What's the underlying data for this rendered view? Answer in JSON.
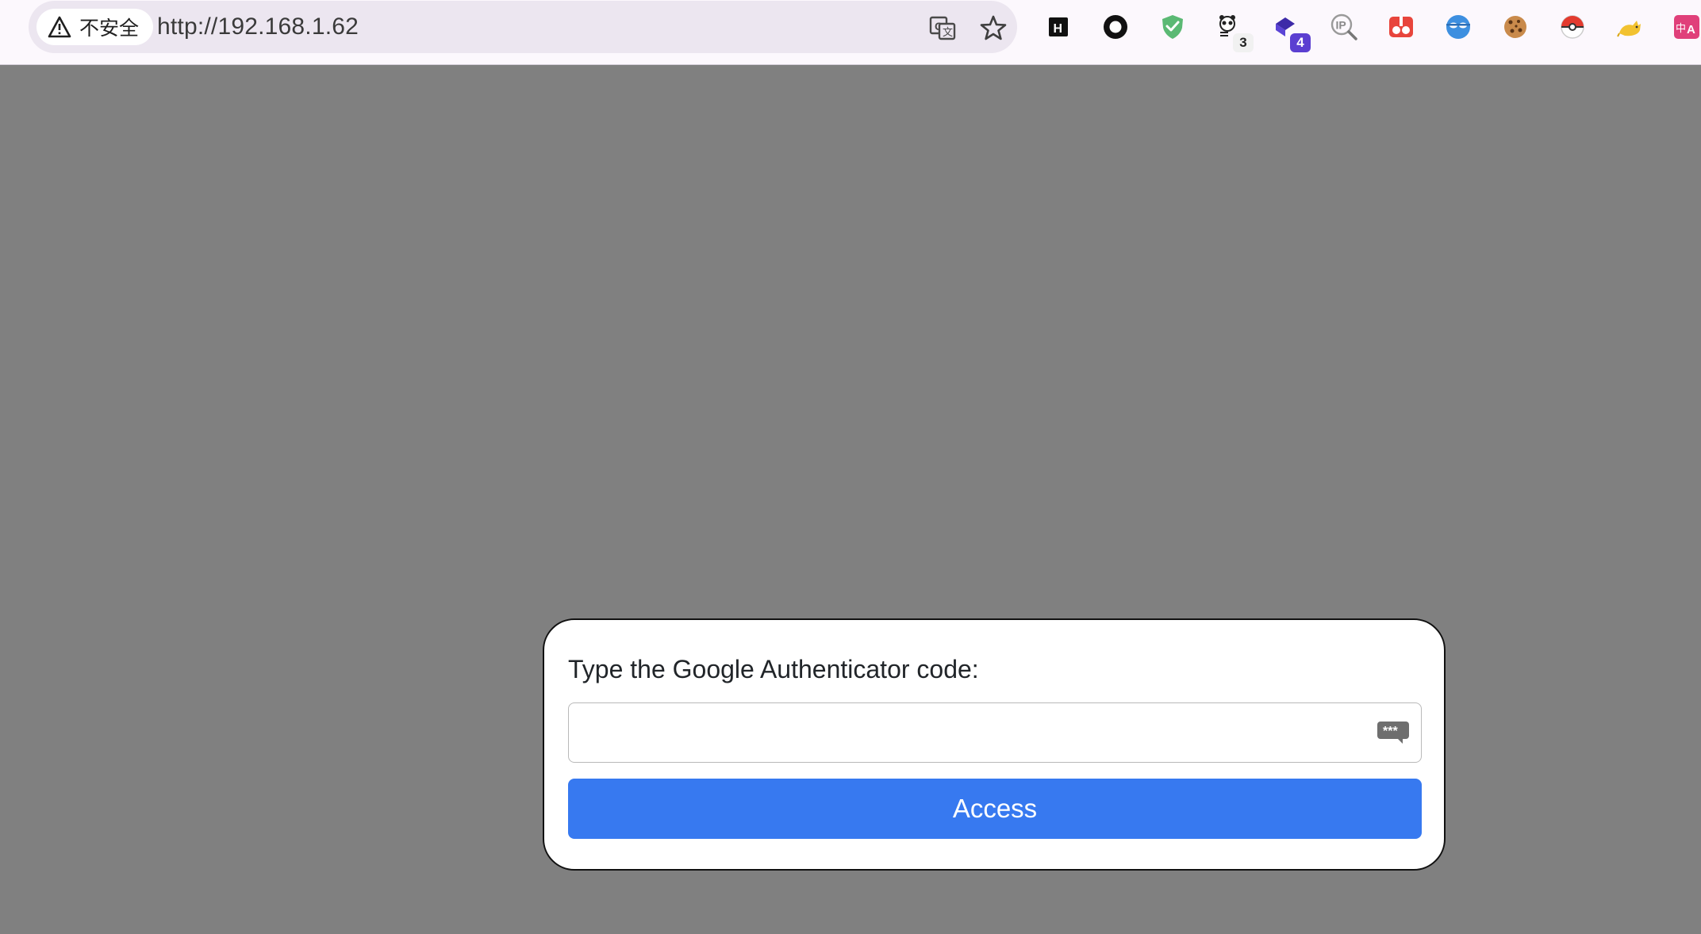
{
  "browser": {
    "security_label": "不安全",
    "url": "http://192.168.1.62",
    "extensions": [
      {
        "name": "h-extension-icon"
      },
      {
        "name": "record-extension-icon"
      },
      {
        "name": "shield-extension-icon"
      },
      {
        "name": "panda-extension-icon",
        "badge": "3"
      },
      {
        "name": "cube-extension-icon",
        "badge": "4"
      },
      {
        "name": "ip-lookup-extension-icon"
      },
      {
        "name": "red-eyes-extension-icon"
      },
      {
        "name": "mask-extension-icon"
      },
      {
        "name": "cookie-extension-icon"
      },
      {
        "name": "pokeball-extension-icon"
      },
      {
        "name": "cat-extension-icon"
      },
      {
        "name": "translate-extension-icon"
      }
    ]
  },
  "dialog": {
    "label": "Type the Google Authenticator code:",
    "input_value": "",
    "button_label": "Access"
  },
  "colors": {
    "page_background": "#808080",
    "button": "#3779f0",
    "toolbar": "#fcf8fd"
  }
}
